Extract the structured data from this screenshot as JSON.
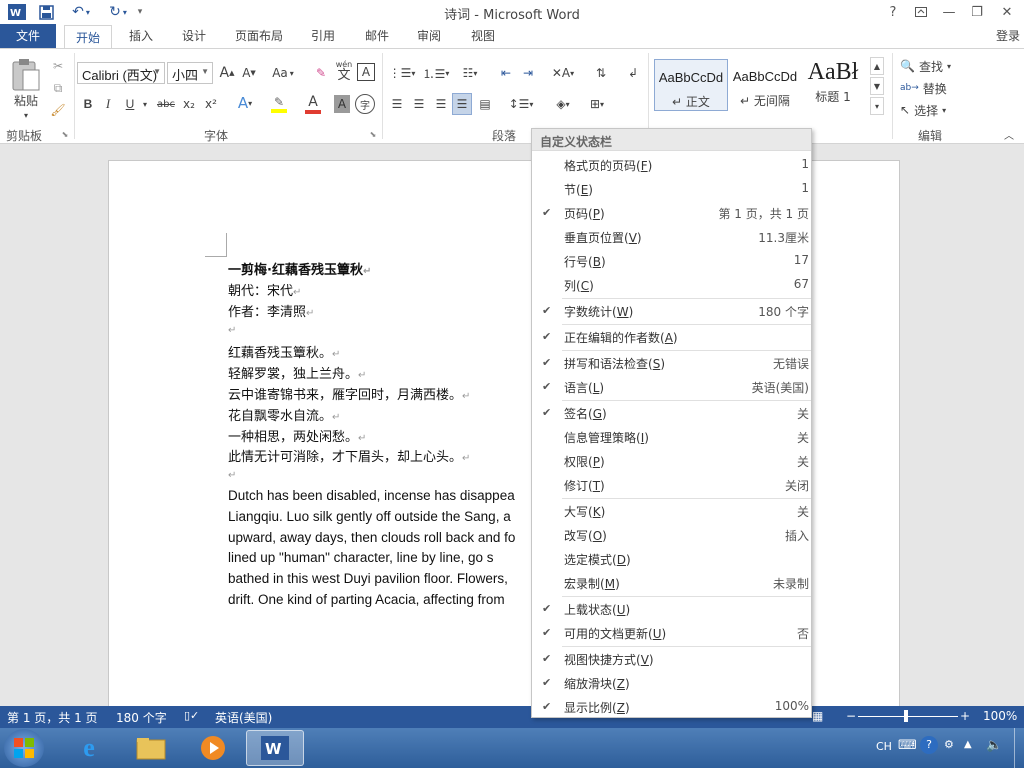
{
  "window": {
    "title": "诗词 - Microsoft Word",
    "help": "?",
    "login": "登录"
  },
  "tabs": [
    "文件",
    "开始",
    "插入",
    "设计",
    "页面布局",
    "引用",
    "邮件",
    "审阅",
    "视图"
  ],
  "ribbon": {
    "clipboard": {
      "paste": "粘贴",
      "label": "剪贴板"
    },
    "font": {
      "name": "Calibri (西文)",
      "size": "小四",
      "label": "字体",
      "aa": "Aa",
      "bold": "B",
      "italic": "I",
      "underline": "U",
      "strike": "abc",
      "sub": "x₂",
      "sup": "x²",
      "wen": "文",
      "phonetic": "wén",
      "a_box": "A",
      "circle": "字"
    },
    "paragraph": {
      "label": "段落"
    },
    "styles": {
      "items": [
        {
          "sample": "AaBbCcDd",
          "name": "正文"
        },
        {
          "sample": "AaBbCcDd",
          "name": "无间隔"
        },
        {
          "sample": "AaBł",
          "name": "标题 1"
        }
      ]
    },
    "editing": {
      "find": "查找",
      "replace": "替换",
      "select": "选择",
      "label": "编辑"
    }
  },
  "document": {
    "title": "一剪梅·红藕香残玉簟秋",
    "lines": [
      "朝代：宋代",
      "作者：李清照",
      "",
      "红藕香残玉簟秋。",
      "轻解罗裳，独上兰舟。",
      "云中谁寄锦书来，雁字回时，月满西楼。",
      "花自飘零水自流。",
      "一种相思，两处闲愁。",
      "此情无计可消除，才下眉头，却上心头。",
      ""
    ],
    "english": [
      "Dutch has been disabled, incense has disappea",
      "Liangqiu. Luo silk gently off outside the Sang, a",
      "upward, away days, then clouds roll back and fo",
      "lined up \"human\" character, line by line, go s",
      "bathed in this west Duyi pavilion floor. Flowers,",
      "drift. One kind of parting Acacia, affecting from"
    ]
  },
  "menu": {
    "title": "自定义状态栏",
    "items": [
      {
        "label": "格式页的页码",
        "key": "F",
        "value": "1",
        "checked": false
      },
      {
        "label": "节",
        "key": "E",
        "value": "1",
        "checked": false
      },
      {
        "label": "页码",
        "key": "P",
        "value": "第 1 页，共 1 页",
        "checked": true
      },
      {
        "label": "垂直页位置",
        "key": "V",
        "value": "11.3厘米",
        "checked": false
      },
      {
        "label": "行号",
        "key": "B",
        "value": "17",
        "checked": false
      },
      {
        "label": "列",
        "key": "C",
        "value": "67",
        "checked": false
      },
      {
        "label": "字数统计",
        "key": "W",
        "value": "180 个字",
        "checked": true
      },
      {
        "label": "正在编辑的作者数",
        "key": "A",
        "value": "",
        "checked": true
      },
      {
        "label": "拼写和语法检查",
        "key": "S",
        "value": "无错误",
        "checked": true
      },
      {
        "label": "语言",
        "key": "L",
        "value": "英语(美国)",
        "checked": true
      },
      {
        "label": "签名",
        "key": "G",
        "value": "关",
        "checked": true
      },
      {
        "label": "信息管理策略",
        "key": "I",
        "value": "关",
        "checked": false
      },
      {
        "label": "权限",
        "key": "P",
        "value": "关",
        "checked": false
      },
      {
        "label": "修订",
        "key": "T",
        "value": "关闭",
        "checked": false
      },
      {
        "label": "大写",
        "key": "K",
        "value": "关",
        "checked": false
      },
      {
        "label": "改写",
        "key": "O",
        "value": "插入",
        "checked": false
      },
      {
        "label": "选定模式",
        "key": "D",
        "value": "",
        "checked": false
      },
      {
        "label": "宏录制",
        "key": "M",
        "value": "未录制",
        "checked": false
      },
      {
        "label": "上载状态",
        "key": "U",
        "value": "",
        "checked": true
      },
      {
        "label": "可用的文档更新",
        "key": "U",
        "value": "否",
        "checked": true
      },
      {
        "label": "视图快捷方式",
        "key": "V",
        "value": "",
        "checked": true
      },
      {
        "label": "缩放滑块",
        "key": "Z",
        "value": "",
        "checked": true
      },
      {
        "label": "显示比例",
        "key": "Z",
        "value": "100%",
        "checked": true
      }
    ]
  },
  "status": {
    "page": "第 1 页，共 1 页",
    "words": "180 个字",
    "lang": "英语(美国)",
    "zoom": "100%"
  },
  "taskbar": {
    "ime": "CH"
  },
  "colors": {
    "accent": "#2b579a",
    "highlight": "#ffff00",
    "fontcolor": "#e03c31"
  }
}
